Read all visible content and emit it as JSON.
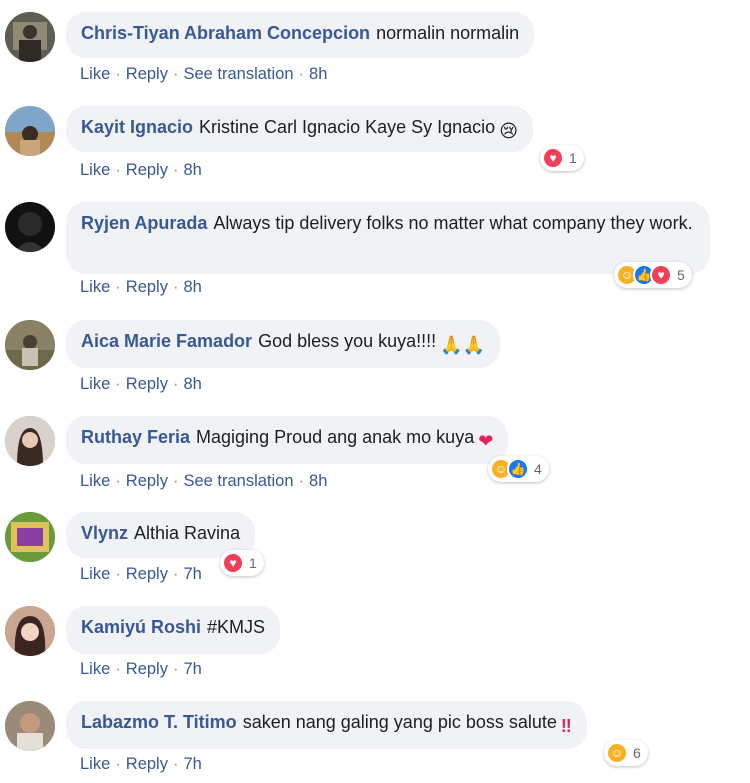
{
  "actions": {
    "like": "Like",
    "reply": "Reply",
    "translate": "See translation"
  },
  "comments": [
    {
      "author": "Chris-Tiyan Abraham Concepcion",
      "text": "normalin normalin",
      "time": "8h",
      "translation": true,
      "reaction_count": "",
      "reactions": []
    },
    {
      "author": "Kayit Ignacio",
      "text": "Kristine Carl Ignacio Kaye Sy Ignacio",
      "emoji": "😢",
      "time": "8h",
      "translation": false,
      "reaction_count": "1",
      "reactions": [
        "love"
      ]
    },
    {
      "author": "Ryjen Apurada",
      "text": "Always tip delivery folks no matter what company they work.",
      "time": "8h",
      "translation": false,
      "reaction_count": "5",
      "reactions": [
        "care",
        "like",
        "love"
      ]
    },
    {
      "author": "Aica Marie Famador",
      "text": "God bless you kuya!!!!",
      "emoji": "🙏🙏",
      "time": "8h",
      "translation": false,
      "reaction_count": "",
      "reactions": []
    },
    {
      "author": "Ruthay Feria",
      "text": "Magiging Proud ang anak mo kuya",
      "emoji": "❤",
      "time": "8h",
      "translation": true,
      "reaction_count": "4",
      "reactions": [
        "care",
        "like"
      ]
    },
    {
      "author": "Vlynz",
      "text": "Althia Ravina",
      "time": "7h",
      "translation": false,
      "reaction_count": "1",
      "reactions": [
        "love"
      ]
    },
    {
      "author": "Kamiyú Roshi",
      "text": "#KMJS",
      "time": "7h",
      "translation": false,
      "reaction_count": "",
      "reactions": []
    },
    {
      "author": "Labazmo T. Titimo",
      "text": "saken nang galing yang pic boss salute",
      "emoji": "‼",
      "time": "7h",
      "translation": false,
      "reaction_count": "6",
      "reactions": [
        "care"
      ]
    }
  ],
  "colors": {
    "name": "#385898",
    "bubble": "#f0f2f5",
    "love": "#f33e58",
    "like": "#1877f2",
    "care": "#f7b125"
  }
}
